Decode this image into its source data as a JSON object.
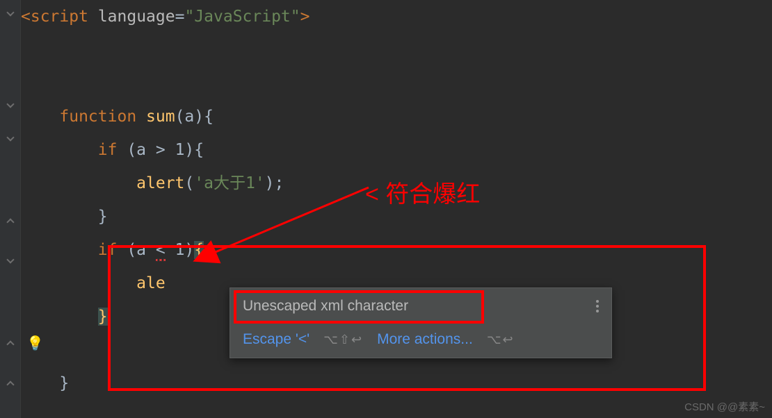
{
  "code": {
    "line1": {
      "open_tag": "<",
      "tag_name": "script",
      "attr_name": "language",
      "eq": "=",
      "attr_value": "\"JavaScript\"",
      "close": ">"
    },
    "line3": {
      "kw_function": "function",
      "fn_name": "sum",
      "params": "(a){"
    },
    "line4": {
      "kw_if": "if",
      "cond": " (a > 1){"
    },
    "line5": {
      "fn_alert": "alert",
      "open": "(",
      "str": "'a大于1'",
      "close": ");"
    },
    "line6": {
      "brace": "}"
    },
    "line7": {
      "kw_if": "if",
      "pre": " (a ",
      "lt": "<",
      "post": " 1)",
      "brace": "{"
    },
    "line8": {
      "partial": "ale"
    },
    "line9": {
      "brace": "}"
    },
    "line11": {
      "brace": "}"
    }
  },
  "tooltip": {
    "title": "Unescaped xml character",
    "action1": "Escape '<'",
    "shortcut1": "⌥⇧↩",
    "action2": "More actions...",
    "shortcut2": "⌥↩"
  },
  "annotation": {
    "text": "< 符合爆红"
  },
  "watermark": "CSDN @@素素~"
}
